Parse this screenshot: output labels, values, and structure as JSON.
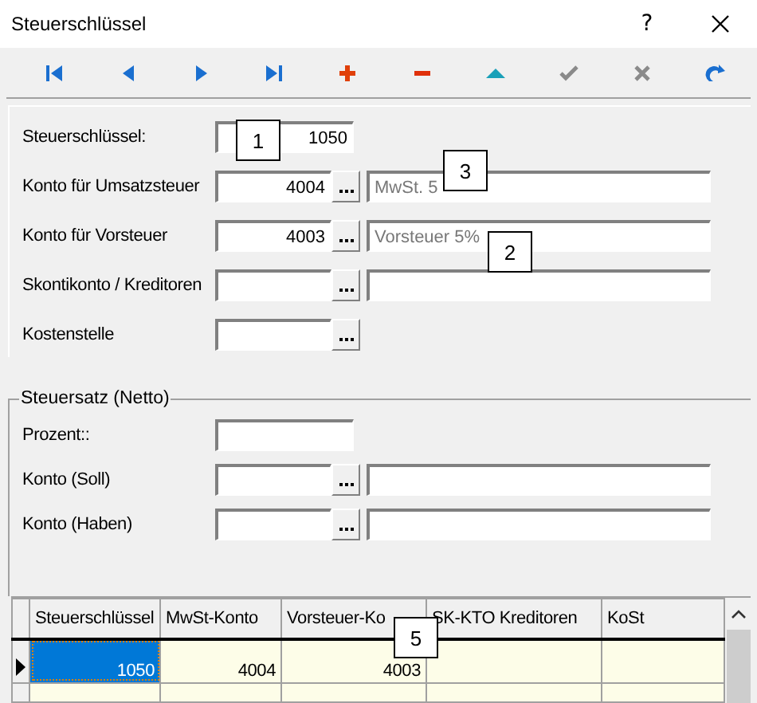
{
  "window": {
    "title": "Steuerschlüssel",
    "help_button": "?"
  },
  "toolbar": [
    {
      "kind": "first",
      "disabled": false
    },
    {
      "kind": "prior",
      "disabled": false
    },
    {
      "kind": "next",
      "disabled": false
    },
    {
      "kind": "last",
      "disabled": false
    },
    {
      "kind": "insert",
      "disabled": false
    },
    {
      "kind": "delete",
      "disabled": false
    },
    {
      "kind": "edit",
      "disabled": false
    },
    {
      "kind": "post",
      "disabled": true
    },
    {
      "kind": "cancel",
      "disabled": true
    },
    {
      "kind": "refresh",
      "disabled": false
    }
  ],
  "form": [
    {
      "label": "Steuerschlüssel:",
      "kind": "code",
      "value": "1050"
    },
    {
      "label": "Konto für Umsatzsteuer",
      "kind": "lookup_description",
      "value": "4004",
      "description": "MwSt. 5"
    },
    {
      "label": "Konto für Vorsteuer",
      "kind": "lookup_description",
      "value": "4003",
      "description": "Vorsteuer 5%"
    },
    {
      "label": "Skontikonto / Kreditoren",
      "kind": "lookup_description"
    },
    {
      "label": "Kostenstelle",
      "kind": "lookup"
    }
  ],
  "tax_rate": {
    "title": "Steuersatz (Netto)",
    "rows": [
      {
        "label": "Prozent::",
        "kind": "code"
      },
      {
        "label": "Konto (Soll)",
        "kind": "lookup_description"
      },
      {
        "label": "Konto (Haben)",
        "kind": "lookup_description"
      }
    ]
  },
  "table": {
    "columns": [
      "Steuerschlüssel",
      "MwSt-Konto",
      "Vorsteuer-Ko",
      "SK-KTO Kreditoren",
      "KoSt"
    ],
    "rows": [
      {
        "selected": true,
        "cells": [
          "1050",
          "4004",
          "4003",
          "",
          ""
        ]
      }
    ]
  },
  "callouts": [
    {
      "number": "1"
    },
    {
      "number": "3"
    },
    {
      "number": "2"
    },
    {
      "number": "5"
    }
  ]
}
